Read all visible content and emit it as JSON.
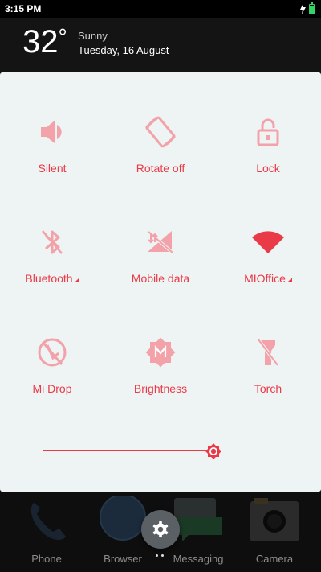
{
  "status_bar": {
    "time": "3:15 PM",
    "battery_level_percent": 80
  },
  "weather": {
    "temperature": "32",
    "unit": "°",
    "condition": "Sunny",
    "date": "Tuesday, 16 August"
  },
  "toggles": [
    {
      "label": "Silent",
      "icon": "speaker-icon",
      "has_menu": false
    },
    {
      "label": "Rotate off",
      "icon": "rotate-icon",
      "has_menu": false
    },
    {
      "label": "Lock",
      "icon": "lock-icon",
      "has_menu": false
    },
    {
      "label": "Bluetooth",
      "icon": "bluetooth-icon",
      "has_menu": true
    },
    {
      "label": "Mobile data",
      "icon": "mobile-data-icon",
      "has_menu": false
    },
    {
      "label": "MIOffice",
      "icon": "wifi-icon",
      "has_menu": true
    },
    {
      "label": "Mi Drop",
      "icon": "mi-drop-icon",
      "has_menu": false
    },
    {
      "label": "Brightness",
      "icon": "brightness-icon",
      "has_menu": false
    },
    {
      "label": "Torch",
      "icon": "torch-icon",
      "has_menu": false
    }
  ],
  "brightness": {
    "value_percent": 74
  },
  "dock": [
    {
      "label": "Phone",
      "icon": "phone-icon"
    },
    {
      "label": "Browser",
      "icon": "browser-icon"
    },
    {
      "label": "Messaging",
      "icon": "messaging-icon"
    },
    {
      "label": "Camera",
      "icon": "camera-icon"
    }
  ],
  "colors": {
    "accent": "#ea3a47",
    "accent_light": "#f2a2a8",
    "panel": "#eef3f3"
  }
}
